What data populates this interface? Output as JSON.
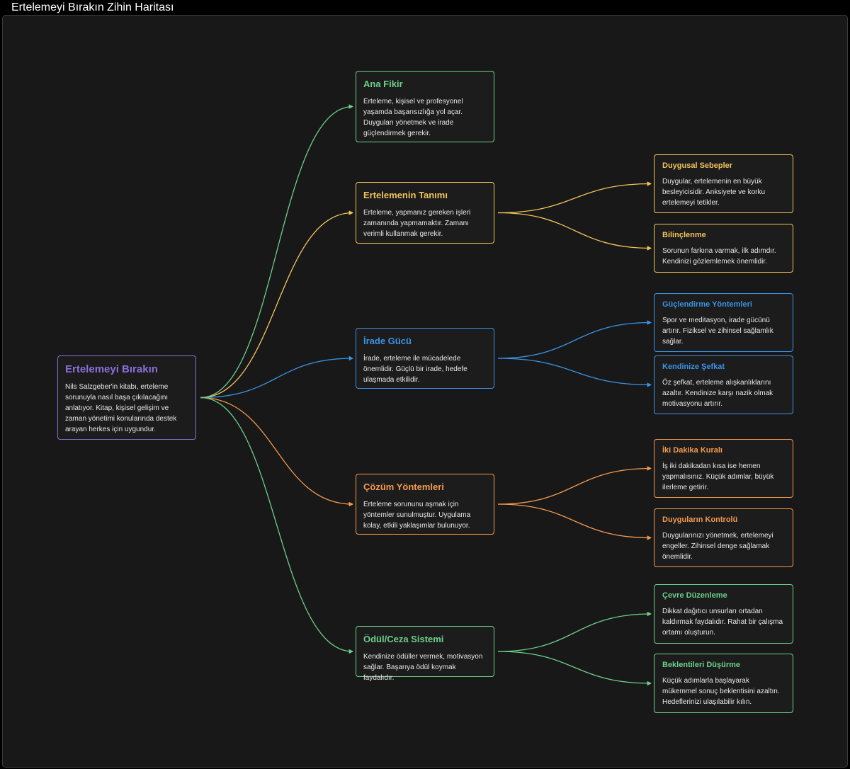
{
  "page": {
    "title": "Ertelemeyi Bırakın Zihin Haritası"
  },
  "colors": {
    "purple": "#8a6fd8",
    "green": "#6cd08a",
    "yellow": "#f2c45a",
    "blue": "#3a93e6",
    "orange": "#f39a4e"
  },
  "root": {
    "title": "Ertelemeyi Bırakın",
    "desc": "Nils Salzgeber'in kitabı, erteleme sorunuyla nasıl başa çıkılacağını anlatıyor. Kitap, kişisel gelişim ve zaman yönetimi konularında destek arayan herkes için uygundur."
  },
  "branches": [
    {
      "title": "Ana Fikir",
      "desc": "Erteleme, kişisel ve profesyonel yaşamda başarısızlığa yol açar. Duyguları yönetmek ve irade güçlendirmek gerekir.",
      "children": []
    },
    {
      "title": "Ertelemenin Tanımı",
      "desc": "Erteleme, yapmanız gereken işleri zamanında yapmamaktır. Zamanı verimli kullanmak gerekir.",
      "children": [
        {
          "title": "Duygusal Sebepler",
          "desc": "Duygular, ertelemenin en büyük besleyicisidir. Anksiyete ve korku ertelemeyi tetikler."
        },
        {
          "title": "Bilinçlenme",
          "desc": "Sorunun farkına varmak, ilk adımdır. Kendinizi gözlemlemek önemlidir."
        }
      ]
    },
    {
      "title": "İrade Gücü",
      "desc": "İrade, erteleme ile mücadelede önemlidir. Güçlü bir irade, hedefe ulaşmada etkilidir.",
      "children": [
        {
          "title": "Güçlendirme Yöntemleri",
          "desc": "Spor ve meditasyon, irade gücünü artırır. Fiziksel ve zihinsel sağlamlık sağlar."
        },
        {
          "title": "Kendinize Şefkat",
          "desc": "Öz şefkat, erteleme alışkanlıklarını azaltır. Kendinize karşı nazik olmak motivasyonu artırır."
        }
      ]
    },
    {
      "title": "Çözüm Yöntemleri",
      "desc": "Erteleme sorununu aşmak için yöntemler sunulmuştur. Uygulama kolay, etkili yaklaşımlar bulunuyor.",
      "children": [
        {
          "title": "İki Dakika Kuralı",
          "desc": "İş iki dakikadan kısa ise hemen yapmalısınız. Küçük adımlar, büyük ilerleme getirir."
        },
        {
          "title": "Duyguların Kontrolü",
          "desc": "Duygularınızı yönetmek, ertelemeyi engeller. Zihinsel denge sağlamak önemlidir."
        }
      ]
    },
    {
      "title": "Ödül/Ceza Sistemi",
      "desc": "Kendinize ödüller vermek, motivasyon sağlar. Başarıya ödül koymak faydalıdır.",
      "children": [
        {
          "title": "Çevre Düzenleme",
          "desc": "Dikkat dağıtıcı unsurları ortadan kaldırmak faydalıdır. Rahat bir çalışma ortamı oluşturun."
        },
        {
          "title": "Beklentileri Düşürme",
          "desc": "Küçük adımlarla başlayarak mükemmel sonuç beklentisini azaltın. Hedeflerinizi ulaşılabilir kılın."
        }
      ]
    }
  ]
}
